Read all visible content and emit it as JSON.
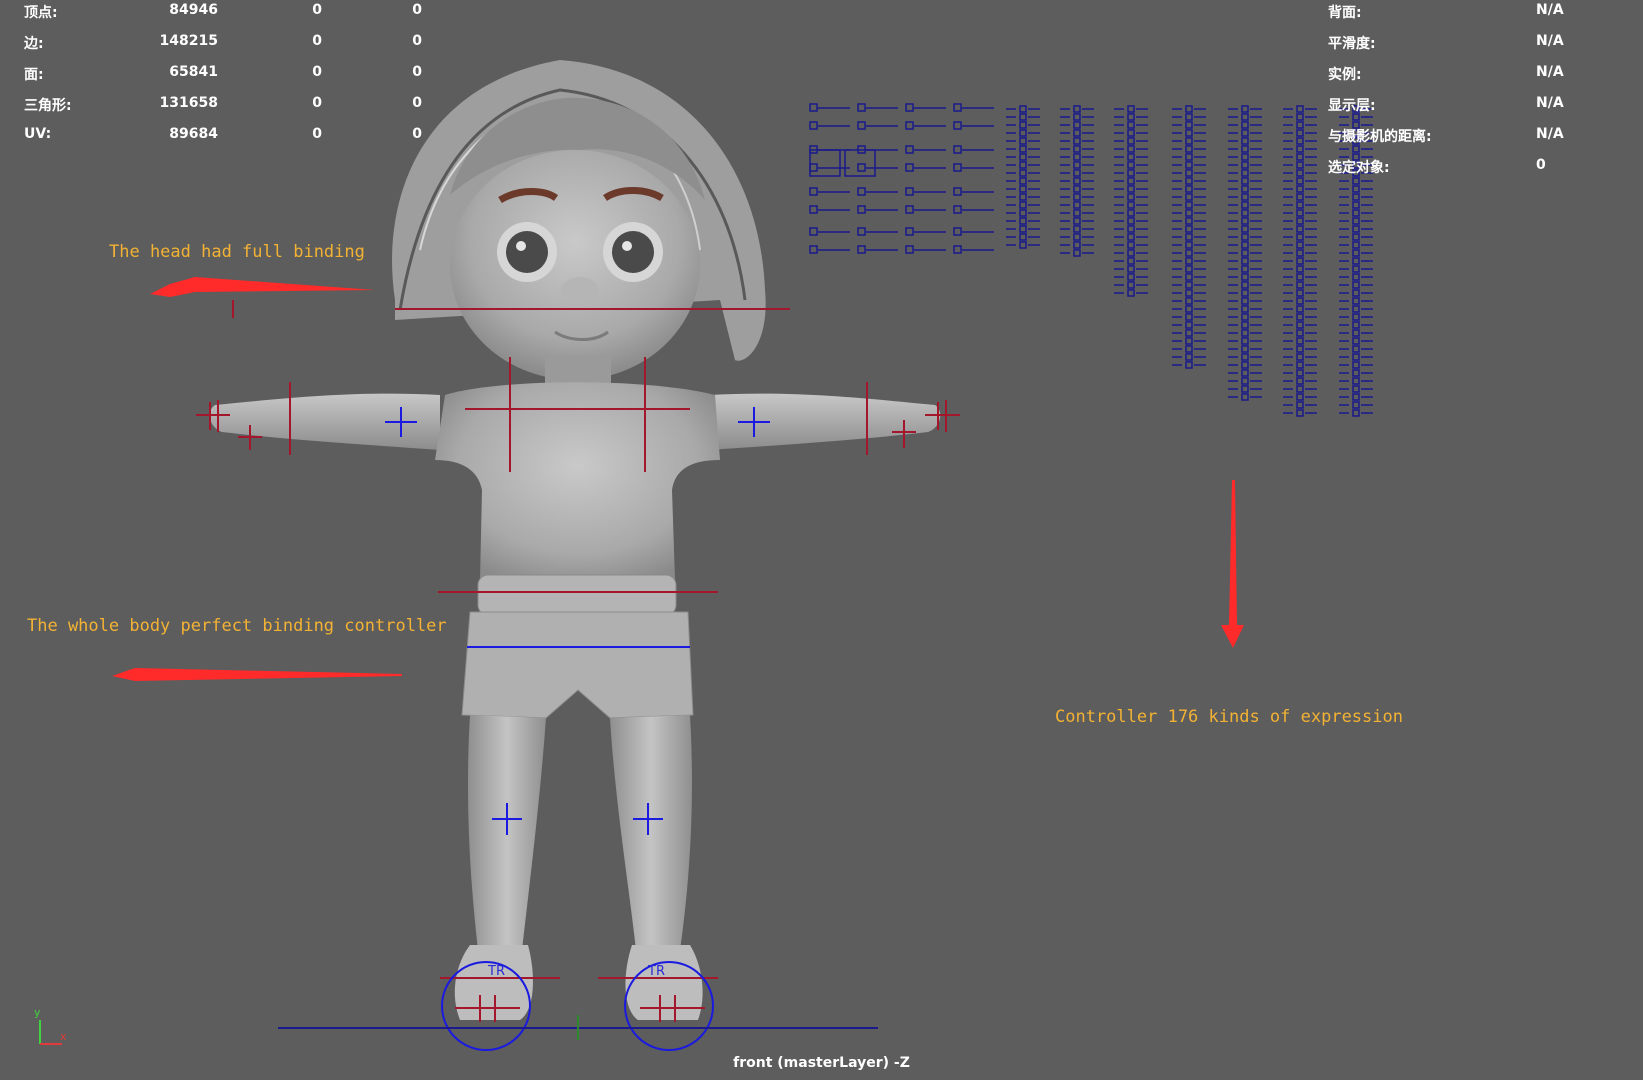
{
  "poly_stats": [
    {
      "label": "顶点:",
      "value": "84946",
      "sel": "0",
      "comp": "0"
    },
    {
      "label": "边:",
      "value": "148215",
      "sel": "0",
      "comp": "0"
    },
    {
      "label": "面:",
      "value": "65841",
      "sel": "0",
      "comp": "0"
    },
    {
      "label": "三角形:",
      "value": "131658",
      "sel": "0",
      "comp": "0"
    },
    {
      "label": "UV:",
      "value": "89684",
      "sel": "0",
      "comp": "0"
    }
  ],
  "object_info": [
    {
      "label": "背面:",
      "value": "N/A"
    },
    {
      "label": "平滑度:",
      "value": "N/A"
    },
    {
      "label": "实例:",
      "value": "N/A"
    },
    {
      "label": "显示层:",
      "value": "N/A"
    },
    {
      "label": "与摄影机的距离:",
      "value": "N/A"
    },
    {
      "label": "选定对象:",
      "value": "0"
    }
  ],
  "annotations": {
    "head": "The head had full binding",
    "body": "The whole body perfect binding controller",
    "face": "Controller 176 kinds of expression"
  },
  "foot_labels": {
    "left": "TR",
    "right": "TR"
  },
  "camera_label": "front (masterLayer) -Z",
  "axis": {
    "y": "y",
    "x": "x"
  },
  "colors": {
    "background": "#5d5d5d",
    "hud_text": "#ffffff",
    "annotation": "#f3b233",
    "arrow": "#ff2a2a",
    "controller_blue": "#1a1ae0",
    "joint_red": "#a3162c",
    "panel_blue": "#1a1a8c"
  }
}
